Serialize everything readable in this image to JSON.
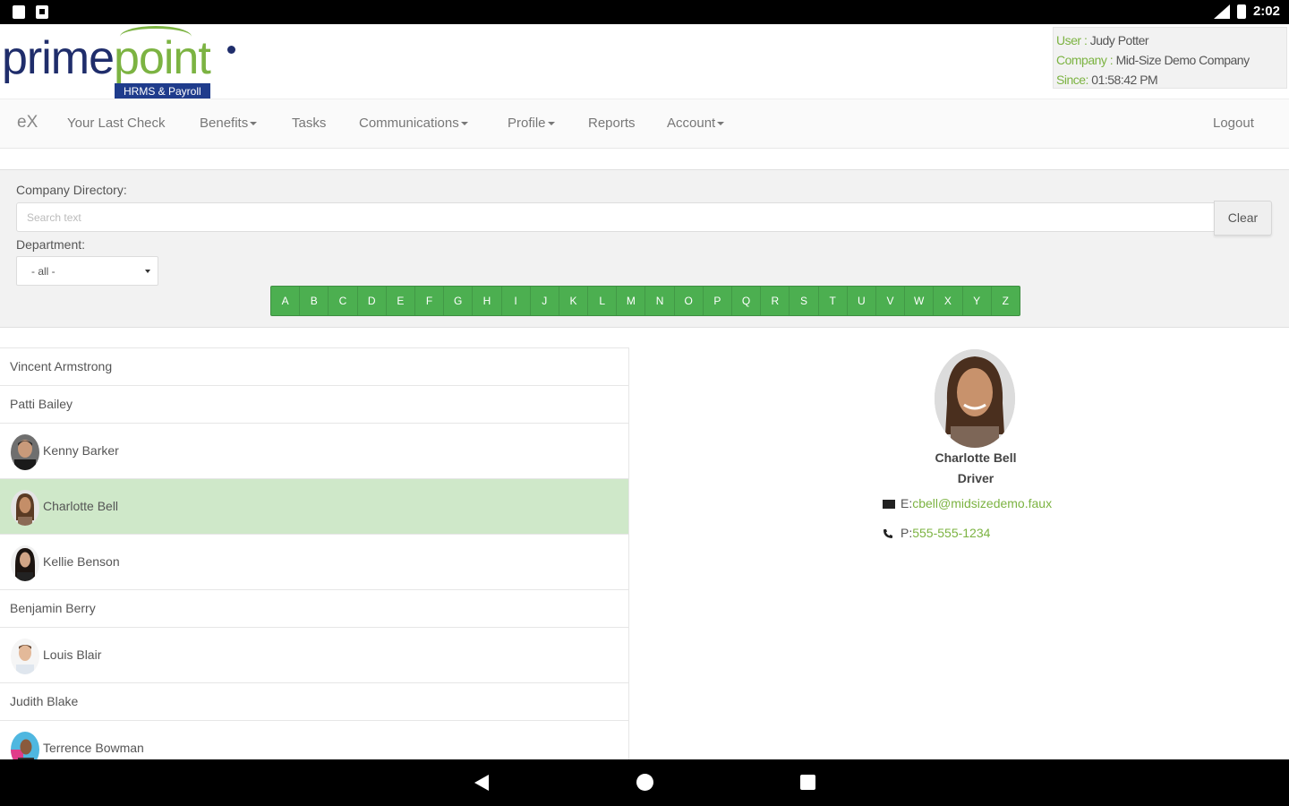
{
  "status_bar": {
    "time": "2:02"
  },
  "logo": {
    "prime": "prime",
    "point": "point",
    "tagline": "HRMS & Payroll"
  },
  "user_info": {
    "user_key": "User :",
    "user_value": " Judy Potter",
    "company_key": "Company :",
    "company_value": " Mid-Size Demo Company",
    "since_key": "Since:",
    "since_value": " 01:58:42 PM"
  },
  "nav": {
    "brand": "eX",
    "items": [
      "Your Last Check",
      "Benefits",
      "Tasks",
      "Communications",
      "Profile",
      "Reports",
      "Account"
    ],
    "logout": "Logout"
  },
  "directory": {
    "label": "Company Directory:",
    "search_placeholder": "Search text",
    "clear_label": "Clear",
    "department_label": "Department:",
    "department_selected": "- all -",
    "letters": [
      "A",
      "B",
      "C",
      "D",
      "E",
      "F",
      "G",
      "H",
      "I",
      "J",
      "K",
      "L",
      "M",
      "N",
      "O",
      "P",
      "Q",
      "R",
      "S",
      "T",
      "U",
      "V",
      "W",
      "X",
      "Y",
      "Z"
    ]
  },
  "employees": [
    {
      "name": "Vincent Armstrong",
      "has_photo": false
    },
    {
      "name": "Patti Bailey",
      "has_photo": false
    },
    {
      "name": "Kenny Barker",
      "has_photo": true
    },
    {
      "name": "Charlotte Bell",
      "has_photo": true,
      "selected": true
    },
    {
      "name": "Kellie Benson",
      "has_photo": true
    },
    {
      "name": "Benjamin Berry",
      "has_photo": false
    },
    {
      "name": "Louis Blair",
      "has_photo": true
    },
    {
      "name": "Judith Blake",
      "has_photo": false
    },
    {
      "name": "Terrence Bowman",
      "has_photo": true
    }
  ],
  "detail": {
    "name": "Charlotte Bell",
    "title": "Driver",
    "email_prefix": "E:",
    "email": "cbell@midsizedemo.faux",
    "phone_prefix": "P:",
    "phone": "555-555-1234"
  },
  "colors": {
    "brand_green": "#7cb342",
    "brand_navy": "#1f2d6b",
    "alpha_green": "#4caf50",
    "selected_row": "#cfe8c9"
  }
}
